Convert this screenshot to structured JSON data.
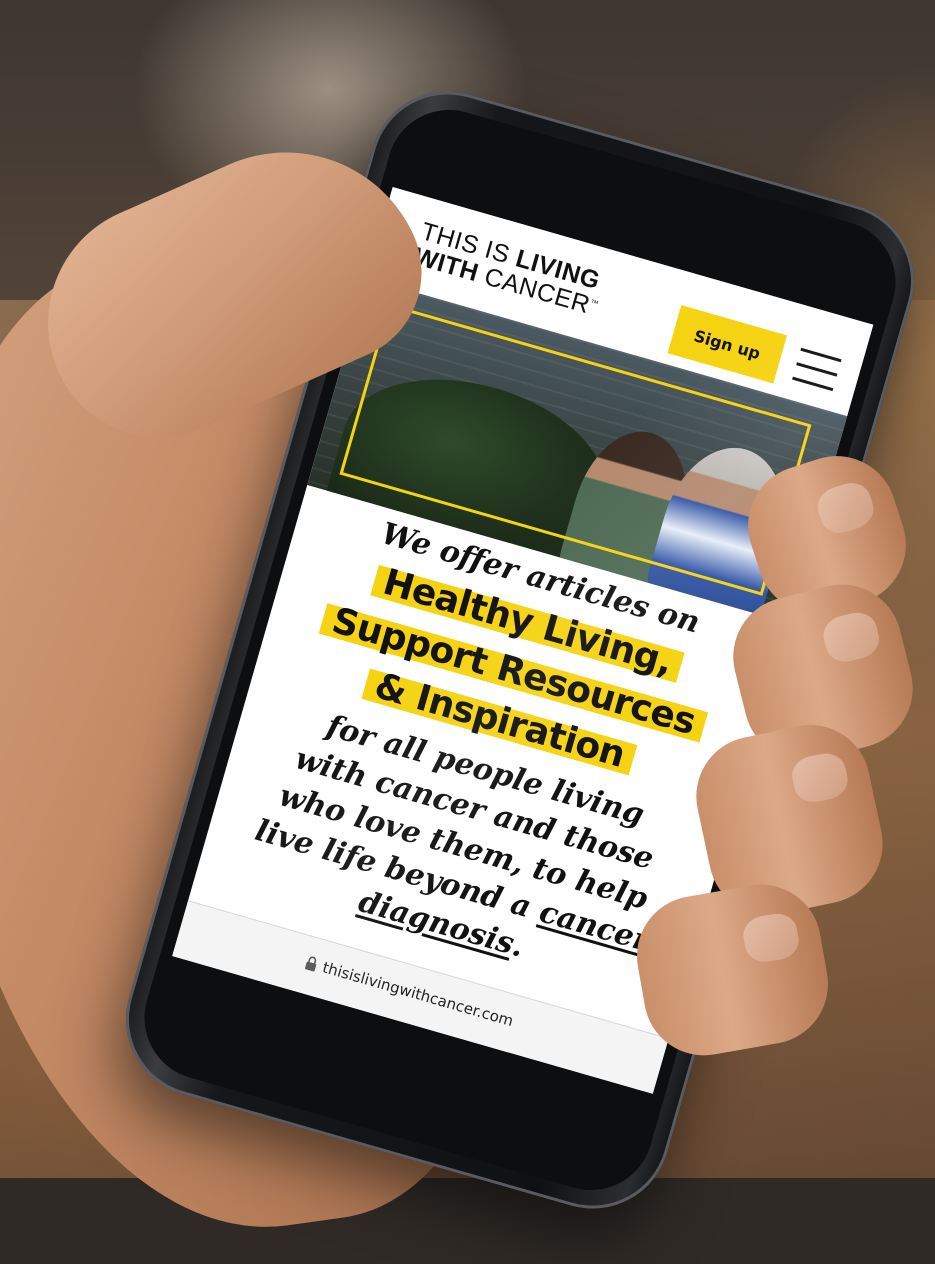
{
  "header": {
    "logo_line1_light": "THIS IS ",
    "logo_line1_bold": "LIVING",
    "logo_line2_bold": "WITH",
    "logo_line2_light": " CANCER",
    "logo_tm": "™",
    "signup_label": "Sign up",
    "menu_icon": "hamburger-menu-icon"
  },
  "hero": {
    "frame_color": "#f5d312",
    "description_icon": "photo-two-women"
  },
  "main": {
    "intro": "We offer articles on",
    "topics": [
      "Healthy Living,",
      "Support Resources",
      "& Inspiration"
    ],
    "body_line1": "for all people living",
    "body_line2": "with cancer and those",
    "body_line3": "who love them, to help",
    "body_line4": "live life beyond a ",
    "body_link1": "cancer",
    "body_link2": "diagnosis",
    "body_end": "."
  },
  "browser": {
    "lock_icon": "lock-icon",
    "url": "thisislivingwithcancer.com"
  },
  "colors": {
    "accent": "#f5d312",
    "text": "#111111",
    "background": "#ffffff"
  }
}
